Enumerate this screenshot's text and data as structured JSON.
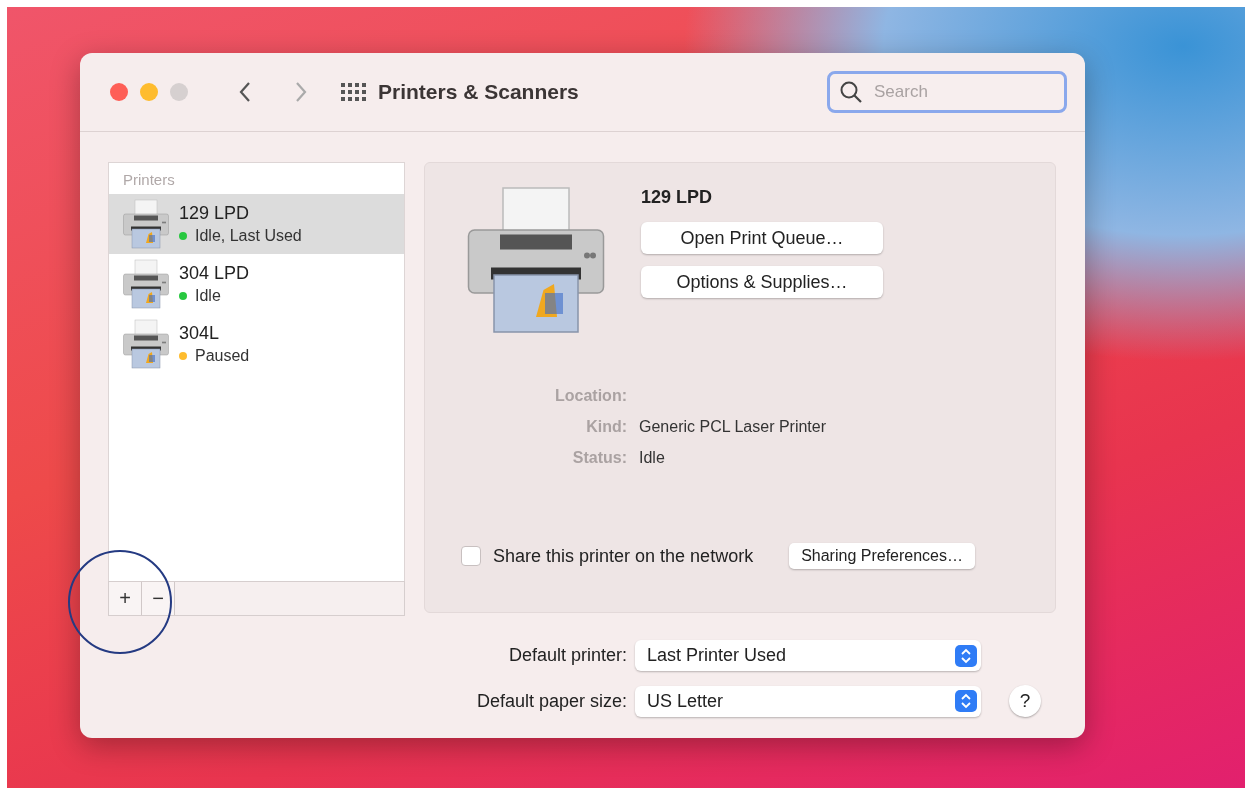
{
  "window": {
    "title": "Printers & Scanners"
  },
  "search": {
    "placeholder": "Search"
  },
  "printers": {
    "header": "Printers",
    "items": [
      {
        "name": "129 LPD",
        "status": "Idle, Last Used",
        "color": "#28c840",
        "selected": true
      },
      {
        "name": "304 LPD",
        "status": "Idle",
        "color": "#28c840",
        "selected": false
      },
      {
        "name": "304L",
        "status": "Paused",
        "color": "#febc2e",
        "selected": false
      }
    ]
  },
  "list_buttons": [
    "+",
    "−"
  ],
  "detail": {
    "name": "129 LPD",
    "buttons": [
      "Open Print Queue…",
      "Options & Supplies…"
    ],
    "fields": [
      {
        "label": "Location:"
      },
      {
        "label": "Kind:",
        "value": "Generic PCL Laser Printer"
      },
      {
        "label": "Status:",
        "value": "Idle"
      }
    ],
    "share": {
      "label": "Share this printer on the network",
      "checked": false
    },
    "sharing_button": "Sharing Preferences…"
  },
  "defaults": [
    {
      "label": "Default printer:",
      "value": "Last Printer Used"
    },
    {
      "label": "Default paper size:",
      "value": "US Letter"
    }
  ],
  "help": "?"
}
